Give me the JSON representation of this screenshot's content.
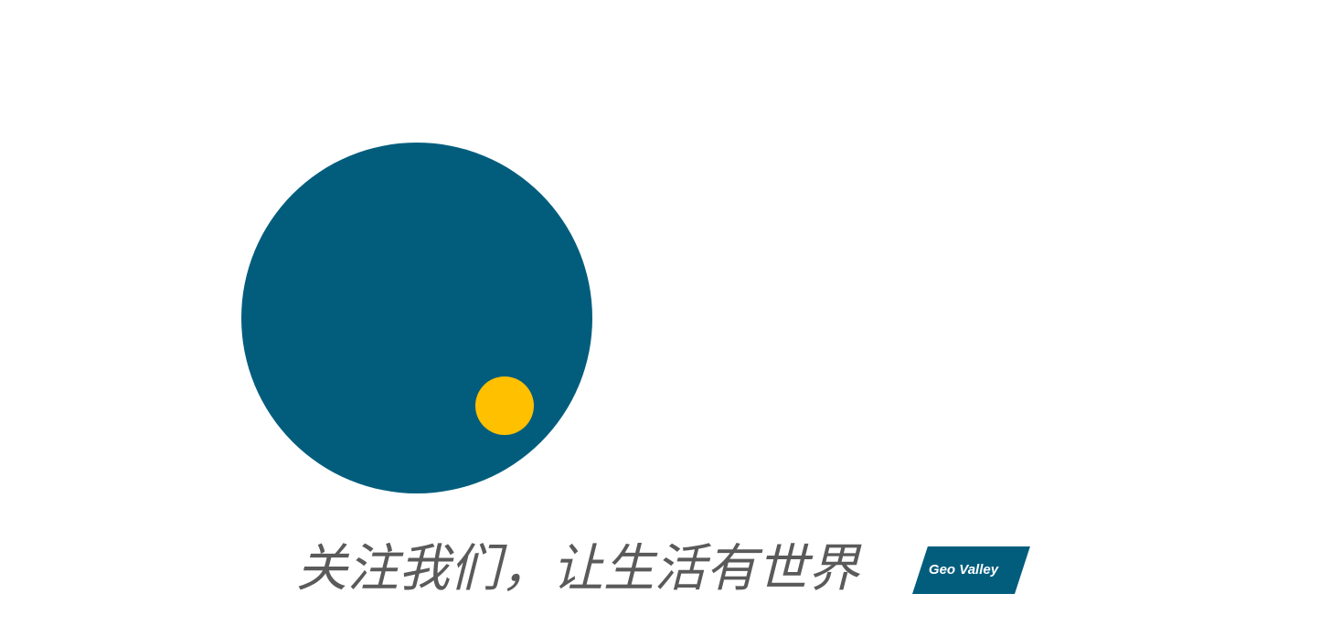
{
  "slogan": "关注我们，让生活有世界",
  "badge": {
    "text": "Geo Valley"
  },
  "colors": {
    "primary": "#025d7d",
    "accent": "#ffc000",
    "text": "#5a5a5a",
    "background": "#ffffff"
  }
}
